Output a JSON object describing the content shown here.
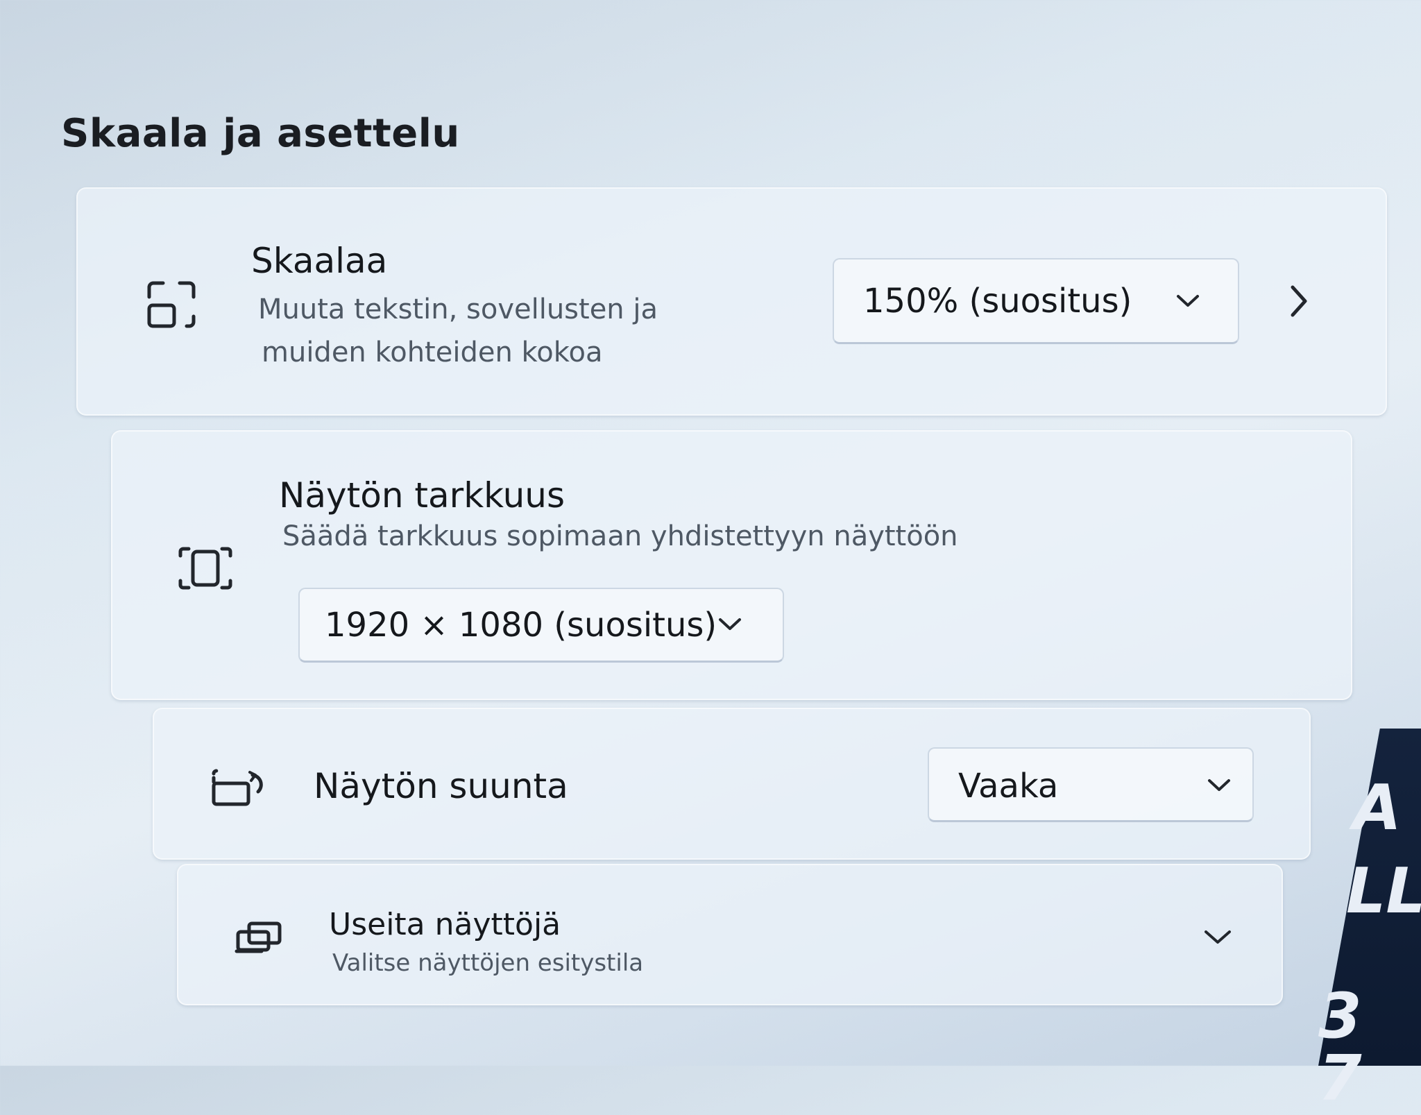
{
  "section": {
    "title": "Skaala ja asettelu"
  },
  "scale": {
    "icon": "scale-icon",
    "title": "Skaalaa",
    "description_line1": "Muuta tekstin, sovellusten ja",
    "description_line2": "muiden kohteiden kokoa",
    "dropdown_value": "150% (suositus)",
    "expand_icon": "chevron-right-icon"
  },
  "resolution": {
    "icon": "resolution-icon",
    "title": "Näytön tarkkuus",
    "description": "Säädä tarkkuus sopimaan yhdistettyyn näyttöön",
    "dropdown_value": "1920 × 1080 (suositus)"
  },
  "orientation": {
    "icon": "orientation-icon",
    "title": "Näytön suunta",
    "dropdown_value": "Vaaka"
  },
  "multiple_displays": {
    "icon": "multiple-displays-icon",
    "title": "Useita näyttöjä",
    "description": "Valitse näyttöjen esitystila",
    "expand_icon": "chevron-down-icon"
  },
  "background_text": {
    "line1": "A",
    "line2": "LL",
    "line3": "3 7"
  }
}
